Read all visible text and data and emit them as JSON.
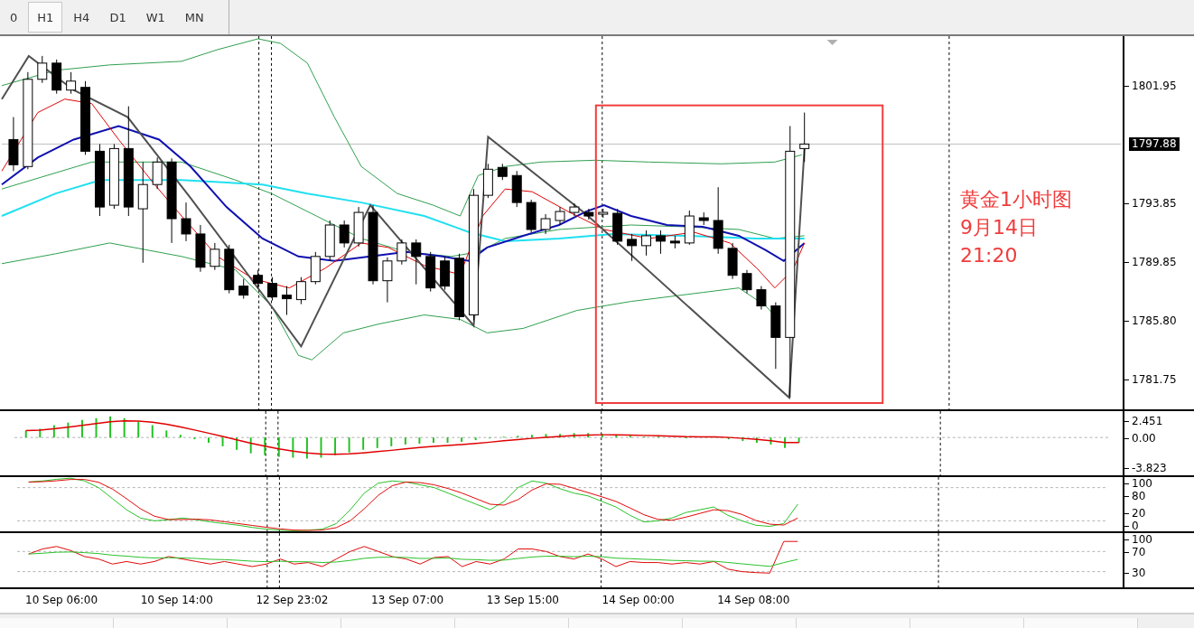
{
  "toolbar": {
    "timeframes": [
      {
        "label": "0",
        "selected": false
      },
      {
        "label": "H1",
        "selected": true
      },
      {
        "label": "H4",
        "selected": false
      },
      {
        "label": "D1",
        "selected": false
      },
      {
        "label": "W1",
        "selected": false
      },
      {
        "label": "MN",
        "selected": false
      }
    ]
  },
  "price_axis": {
    "labels": [
      "1801.95",
      "1793.85",
      "1789.85",
      "1785.80",
      "1781.75"
    ],
    "current_price": "1797.88"
  },
  "annotation": {
    "lines": [
      "黄金1小时图",
      "9月14日",
      "21:20"
    ]
  },
  "macd_axis": {
    "labels": [
      "2.451",
      "0.00",
      "-3.823"
    ]
  },
  "stochastic_axis": {
    "labels": [
      "100",
      "80",
      "20",
      "0"
    ]
  },
  "rsi_axis": {
    "labels": [
      "100",
      "70",
      "30"
    ]
  },
  "time_axis": {
    "labels": [
      "10 Sep 06:00",
      "10 Sep 14:00",
      "12 Sep 23:02",
      "13 Sep 07:00",
      "13 Sep 15:00",
      "14 Sep 00:00",
      "14 Sep 08:00"
    ]
  }
}
